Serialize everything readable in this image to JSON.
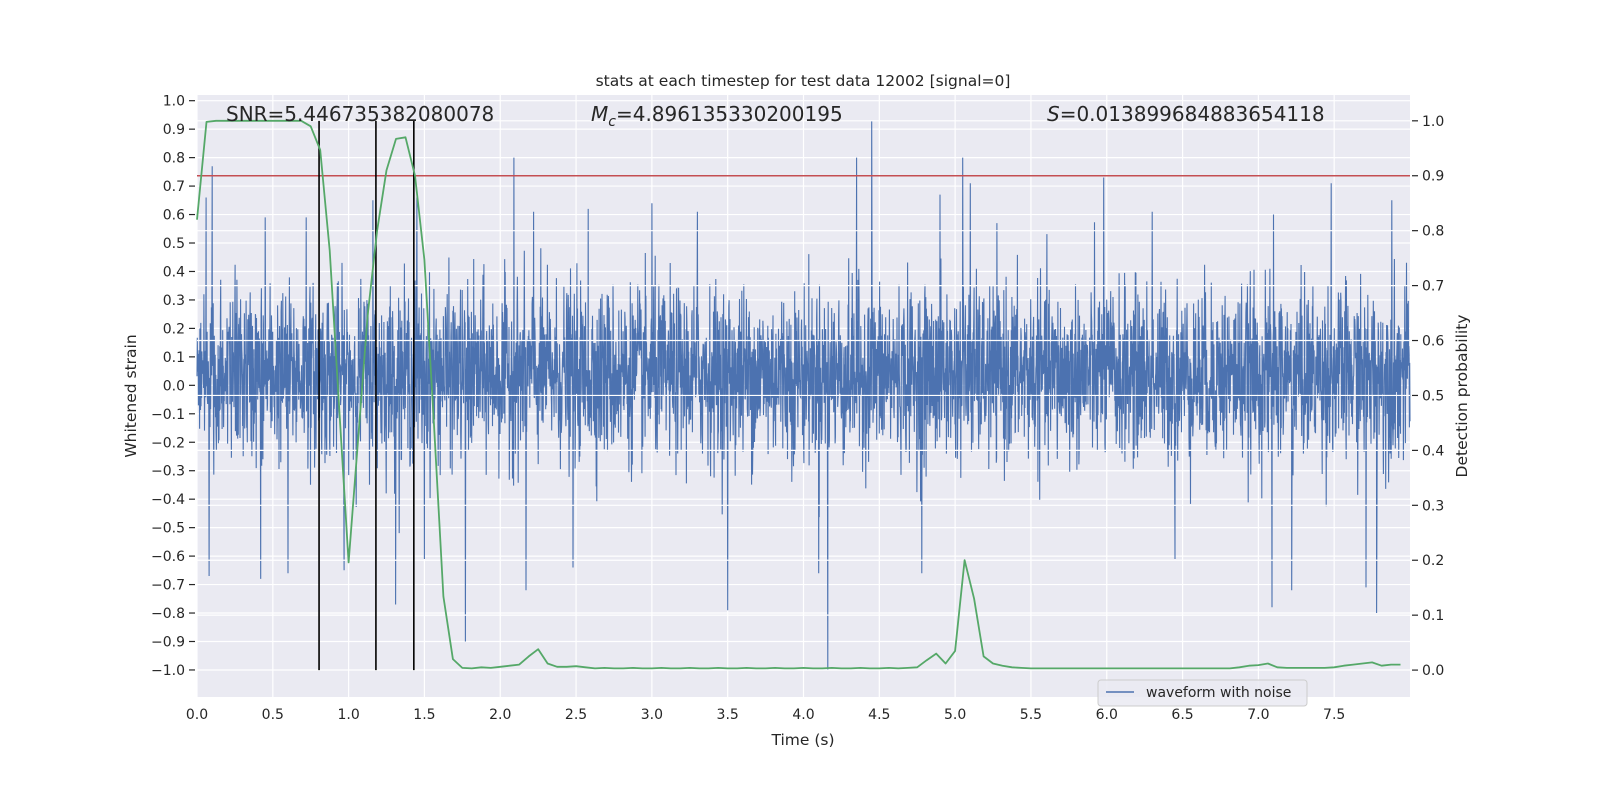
{
  "chart_data": {
    "type": "line",
    "title": "stats at each timestep for test data 12002 [signal=0]",
    "xlabel": "Time (s)",
    "ylabel_left": "Whitened strain",
    "ylabel_right": "Detection probability",
    "xlim": [
      0,
      8
    ],
    "ylim_left": [
      -1.095,
      1.02
    ],
    "ylim_right": [
      -0.049,
      1.047
    ],
    "grid": true,
    "background_color": "#eaeaf2",
    "x_ticks": [
      "0.0",
      "0.5",
      "1.0",
      "1.5",
      "2.0",
      "2.5",
      "3.0",
      "3.5",
      "4.0",
      "4.5",
      "5.0",
      "5.5",
      "6.0",
      "6.5",
      "7.0",
      "7.5"
    ],
    "y_left_ticks": [
      "1.0",
      "0.9",
      "0.8",
      "0.7",
      "0.6",
      "0.5",
      "0.4",
      "0.3",
      "0.2",
      "0.1",
      "0.0",
      "−0.1",
      "−0.2",
      "−0.3",
      "−0.4",
      "−0.5",
      "−0.6",
      "−0.7",
      "−0.8",
      "−0.9",
      "−1.0"
    ],
    "y_right_ticks": [
      "1.0",
      "0.9",
      "0.8",
      "0.7",
      "0.6",
      "0.5",
      "0.4",
      "0.3",
      "0.2",
      "0.1",
      "0.0"
    ],
    "annotations": {
      "snr": "SNR=5.446735382080078",
      "mc_symbol": "M",
      "mc_sub": "c",
      "mc_value": "=4.896135330200195",
      "s_symbol": "S",
      "s_value": "=0.013899684883654118"
    },
    "legend": {
      "placement": "lower right",
      "entries": [
        "waveform with noise"
      ]
    },
    "series": [
      {
        "name": "waveform with noise",
        "axis": "left",
        "color": "#4c72b0",
        "typical_band": [
          -0.25,
          0.33
        ],
        "notable_extremes": [
          [
            0.06,
            0.66
          ],
          [
            0.1,
            0.77
          ],
          [
            0.45,
            0.59
          ],
          [
            0.72,
            0.59
          ],
          [
            1.16,
            0.65
          ],
          [
            1.45,
            0.66
          ],
          [
            1.77,
            0.62
          ],
          [
            2.09,
            0.8
          ],
          [
            2.22,
            0.61
          ],
          [
            2.58,
            0.62
          ],
          [
            3.0,
            0.64
          ],
          [
            3.3,
            0.61
          ],
          [
            4.35,
            0.8
          ],
          [
            4.45,
            0.93
          ],
          [
            4.9,
            0.67
          ],
          [
            5.05,
            0.8
          ],
          [
            5.1,
            0.71
          ],
          [
            5.98,
            0.73
          ],
          [
            6.3,
            0.61
          ],
          [
            7.1,
            0.6
          ],
          [
            7.48,
            0.71
          ],
          [
            7.88,
            0.65
          ],
          [
            0.08,
            -0.67
          ],
          [
            0.42,
            -0.68
          ],
          [
            0.6,
            -0.66
          ],
          [
            0.97,
            -0.65
          ],
          [
            1.31,
            -0.77
          ],
          [
            1.5,
            -0.61
          ],
          [
            1.77,
            -0.9
          ],
          [
            2.17,
            -0.72
          ],
          [
            2.48,
            -0.64
          ],
          [
            3.5,
            -0.79
          ],
          [
            4.1,
            -0.66
          ],
          [
            4.16,
            -1.0
          ],
          [
            4.78,
            -0.66
          ],
          [
            6.45,
            -0.61
          ],
          [
            7.09,
            -0.78
          ],
          [
            7.22,
            -0.72
          ],
          [
            7.71,
            -0.71
          ],
          [
            7.78,
            -0.8
          ]
        ]
      },
      {
        "axis": "right",
        "color": "#55a868",
        "x_step": 0.0625,
        "values": [
          0.82,
          0.998,
          1,
          1,
          1,
          1,
          1,
          1,
          1,
          1,
          1,
          1,
          0.99,
          0.947,
          0.764,
          0.48,
          0.196,
          0.42,
          0.645,
          0.8,
          0.91,
          0.967,
          0.97,
          0.9,
          0.747,
          0.45,
          0.134,
          0.02,
          0.004,
          0.003,
          0.005,
          0.004,
          0.006,
          0.008,
          0.01,
          0.025,
          0.038,
          0.012,
          0.006,
          0.006,
          0.007,
          0.005,
          0.003,
          0.004,
          0.003,
          0.003,
          0.004,
          0.003,
          0.003,
          0.004,
          0.003,
          0.003,
          0.004,
          0.003,
          0.003,
          0.004,
          0.003,
          0.003,
          0.004,
          0.003,
          0.003,
          0.004,
          0.003,
          0.003,
          0.004,
          0.003,
          0.003,
          0.004,
          0.003,
          0.003,
          0.004,
          0.003,
          0.003,
          0.004,
          0.003,
          0.004,
          0.005,
          0.018,
          0.03,
          0.012,
          0.035,
          0.2,
          0.13,
          0.025,
          0.012,
          0.008,
          0.005,
          0.004,
          0.003,
          0.003,
          0.003,
          0.003,
          0.003,
          0.003,
          0.003,
          0.003,
          0.003,
          0.003,
          0.003,
          0.003,
          0.003,
          0.003,
          0.003,
          0.003,
          0.003,
          0.003,
          0.003,
          0.003,
          0.003,
          0.003,
          0.005,
          0.008,
          0.009,
          0.012,
          0.005,
          0.004,
          0.004,
          0.004,
          0.004,
          0.004,
          0.005,
          0.008,
          0.01,
          0.012,
          0.014,
          0.008,
          0.01,
          0.01
        ]
      }
    ],
    "threshold_line": {
      "axis": "right",
      "value": 0.9,
      "color": "#c44e52"
    },
    "vertical_lines": {
      "color": "#000000",
      "x": [
        0.805,
        1.18,
        1.43
      ],
      "range_right": [
        0,
        1
      ]
    }
  }
}
